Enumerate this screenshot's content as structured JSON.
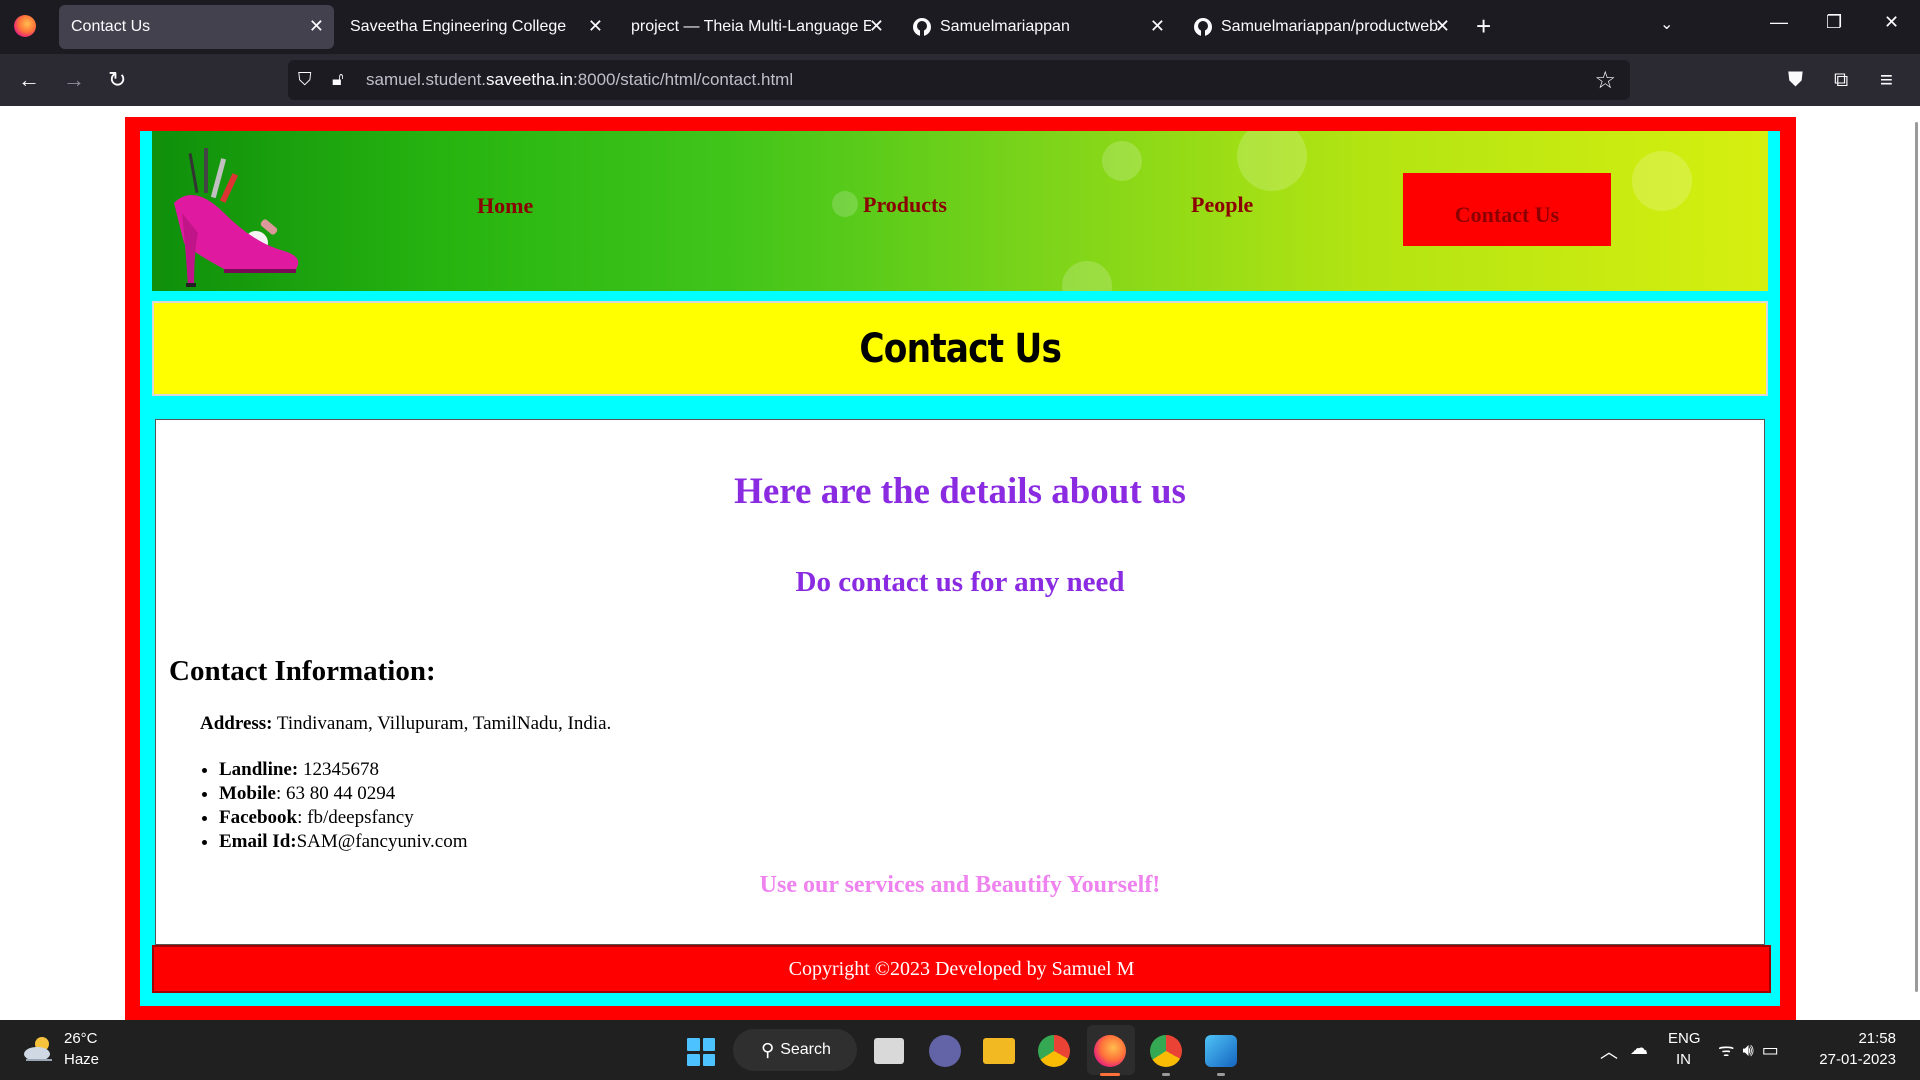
{
  "browser": {
    "tabs": [
      {
        "title": "Contact Us",
        "active": true,
        "icon": "none"
      },
      {
        "title": "Saveetha Engineering College",
        "active": false,
        "icon": "none"
      },
      {
        "title": "project — Theia Multi-Language Ex",
        "active": false,
        "icon": "none"
      },
      {
        "title": "Samuelmariappan",
        "active": false,
        "icon": "github-icon"
      },
      {
        "title": "Samuelmariappan/productweb",
        "active": false,
        "icon": "github-icon"
      }
    ],
    "new_tab": "+",
    "url_host_prefix": "samuel.student.",
    "url_host": "saveetha.in",
    "url_rest": ":8000/static/html/contact.html"
  },
  "page": {
    "colors": {
      "frame": "#ff0000",
      "inner": "#00ffff",
      "title_bg": "#ffff00",
      "heading": "#8a2be2",
      "tagline": "#ee82ee",
      "nav_text": "#8b0000"
    },
    "nav": {
      "home": "Home",
      "products": "Products",
      "people": "People",
      "contact": "Contact Us"
    },
    "title": "Contact Us",
    "heading_main": "Here are the details about us",
    "heading_sub": "Do contact us for any need",
    "info_heading": "Contact Information:",
    "address_label": "Address:",
    "address_value": " Tindivanam, Villupuram, TamilNadu, India.",
    "contacts": [
      {
        "label": "Landline:",
        "value": " 12345678"
      },
      {
        "label": "Mobile",
        "value": ": 63 80 44 0294"
      },
      {
        "label": "Facebook",
        "value": ": fb/deepsfancy"
      },
      {
        "label": "Email Id:",
        "value": "SAM@fancyuniv.com"
      }
    ],
    "tagline": "Use our services and Beautify Yourself!",
    "footer": "Copyright ©2023 Developed by Samuel M"
  },
  "taskbar": {
    "weather_temp": "26°C",
    "weather_desc": "Haze",
    "search_label": "Search",
    "lang_line1": "ENG",
    "lang_line2": "IN",
    "time": "21:58",
    "date": "27-01-2023"
  }
}
